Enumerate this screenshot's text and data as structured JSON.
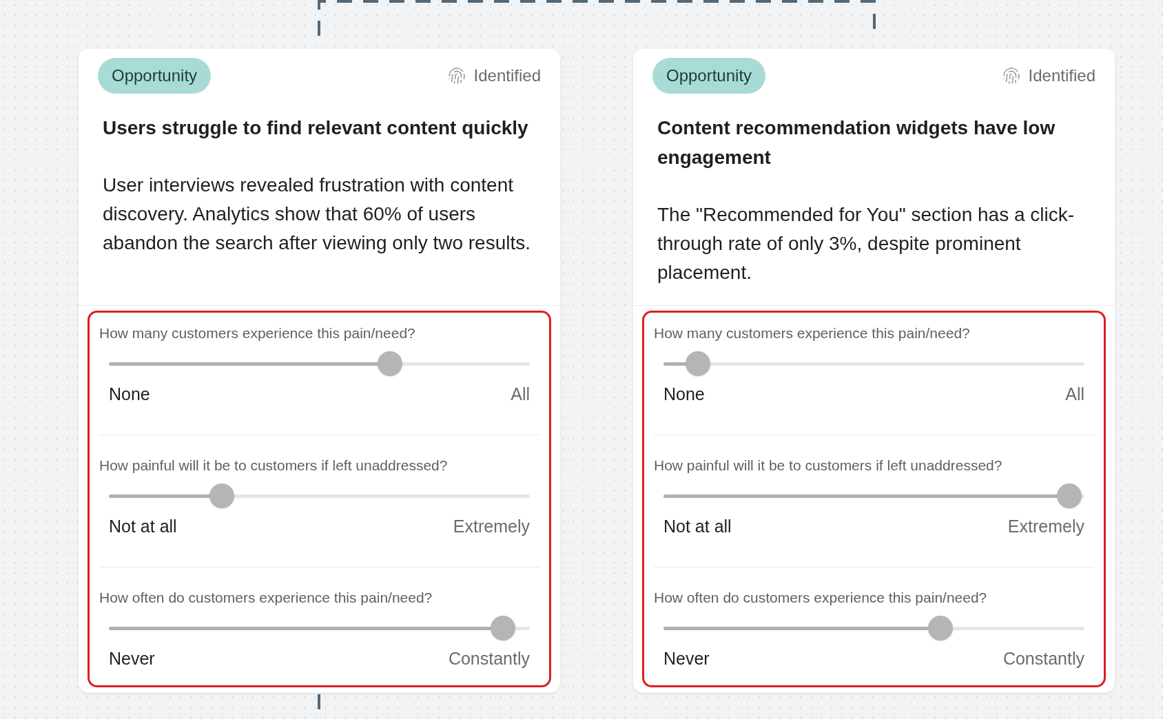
{
  "cards": [
    {
      "tag": "Opportunity",
      "status": "Identified",
      "title": "Users struggle to find relevant content quickly",
      "description": "User interviews revealed frustration with content discovery. Analytics show that 60% of users abandon the search after viewing only two results.",
      "highlighted": true,
      "questions": [
        {
          "question": "How many customers experience this pain/need?",
          "level": 0.68,
          "min_label": "None",
          "max_label": "All"
        },
        {
          "question": "How painful will it be to customers if left unaddressed?",
          "level": 0.25,
          "min_label": "Not at all",
          "max_label": "Extremely"
        },
        {
          "question": "How often do customers experience this pain/need?",
          "level": 0.97,
          "min_label": "Never",
          "max_label": "Constantly"
        }
      ]
    },
    {
      "tag": "Opportunity",
      "status": "Identified",
      "title": "Content recommendation widgets have low engagement",
      "description": "The \"Recommended for You\" section has a click-through rate of only 3%, despite prominent placement.",
      "highlighted": true,
      "questions": [
        {
          "question": "How many customers experience this pain/need?",
          "level": 0.05,
          "min_label": "None",
          "max_label": "All"
        },
        {
          "question": "How painful will it be to customers if left unaddressed?",
          "level": 1,
          "min_label": "Not at all",
          "max_label": "Extremely"
        },
        {
          "question": "How often do customers experience this pain/need?",
          "level": 0.67,
          "min_label": "Never",
          "max_label": "Constantly"
        }
      ]
    }
  ]
}
